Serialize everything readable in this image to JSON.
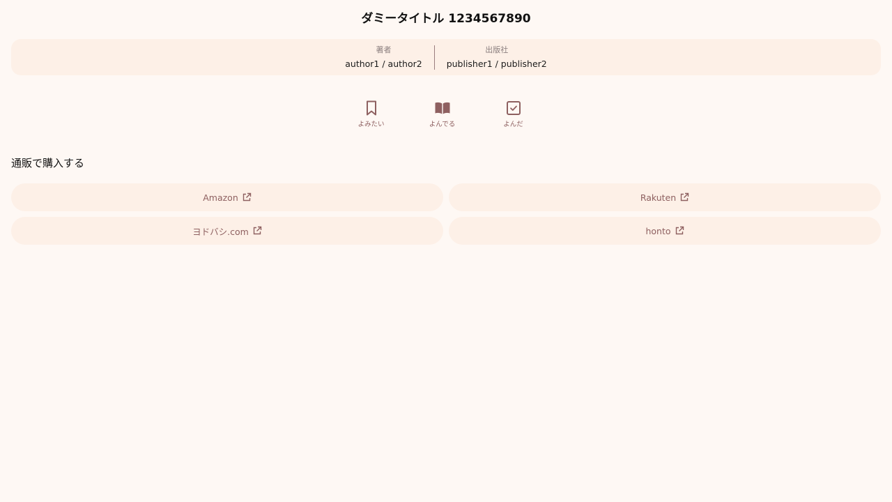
{
  "title": "ダミータイトル 1234567890",
  "meta": {
    "author_label": "著者",
    "author_value": "author1 / author2",
    "publisher_label": "出版社",
    "publisher_value": "publisher1 / publisher2"
  },
  "status": [
    {
      "label": "よみたい",
      "icon": "bookmark-icon"
    },
    {
      "label": "よんでる",
      "icon": "open-book-icon"
    },
    {
      "label": "よんだ",
      "icon": "checkbox-icon"
    }
  ],
  "shop": {
    "heading": "通販で購入する",
    "links": [
      {
        "label": "Amazon",
        "icon": "external-link-icon"
      },
      {
        "label": "Rakuten",
        "icon": "external-link-icon"
      },
      {
        "label": "ヨドバシ.com",
        "icon": "external-link-icon"
      },
      {
        "label": "honto",
        "icon": "external-link-icon"
      }
    ]
  },
  "colors": {
    "background": "#fef8f4",
    "card": "#fdf0e7",
    "accent": "#8e6060"
  }
}
